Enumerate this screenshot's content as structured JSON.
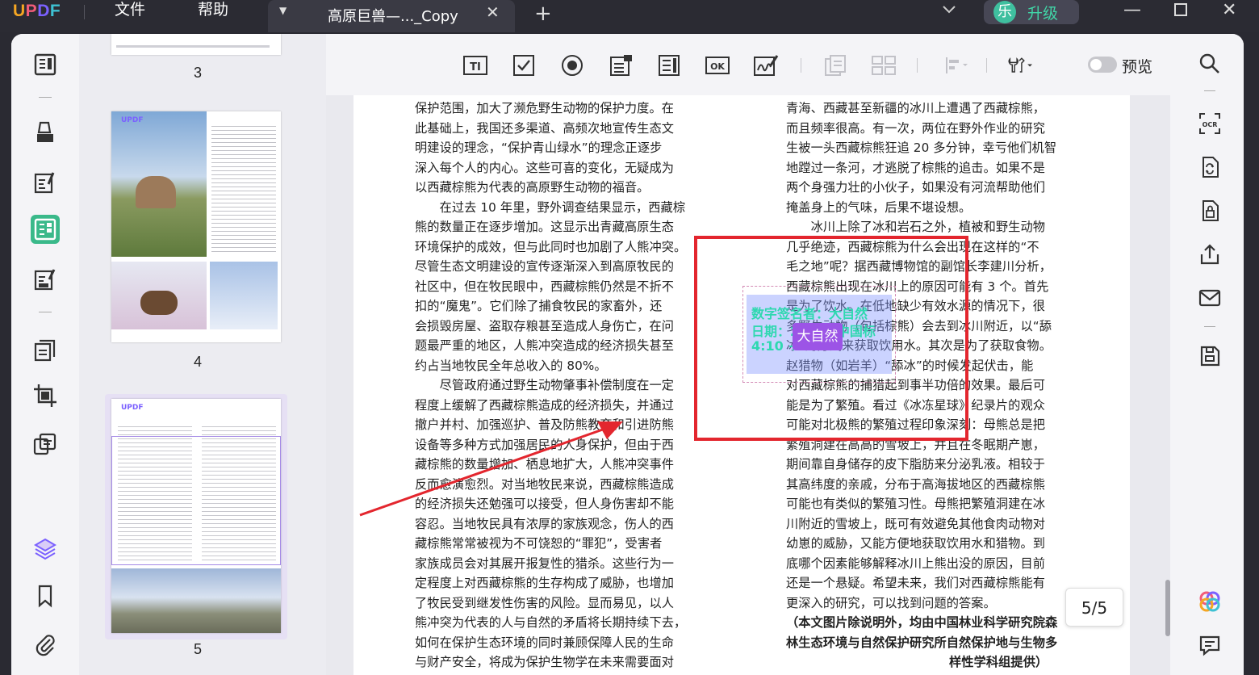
{
  "app": {
    "logo": {
      "u": "U",
      "p": "P",
      "d": "D",
      "f": "F"
    },
    "menu": {
      "file": "文件",
      "help": "帮助"
    },
    "tab_title": "高原巨兽—..._Copy",
    "upgrade": {
      "avatar": "乐",
      "label": "升级"
    },
    "accent_color": "#3ab98a"
  },
  "thumbnails": {
    "pages": [
      {
        "number": "3"
      },
      {
        "number": "4"
      },
      {
        "number": "5"
      }
    ]
  },
  "form_toolbar": {
    "preview_label": "预览",
    "ok_label": "OK",
    "text_label": "TI"
  },
  "document": {
    "left_column": [
      "保护范围，加大了濒危野生动物的保护力度。在",
      "此基础上，我国还多渠道、高频次地宣传生态文",
      "明建设的理念，“保护青山绿水”的理念正逐步",
      "深入每个人的内心。这些可喜的变化，无疑成为",
      "以西藏棕熊为代表的高原野生动物的福音。",
      "　　在过去 10 年里，野外调查结果显示，西藏棕",
      "熊的数量正在逐步增加。这显示出青藏高原生态",
      "环境保护的成效，但与此同时也加剧了人熊冲突。",
      "尽管生态文明建设的宣传逐渐深入到高原牧民的",
      "社区中，但在牧民眼中，西藏棕熊仍然是不折不",
      "扣的“魔鬼”。它们除了捕食牧民的家畜外，还",
      "会损毁房屋、盗取存粮甚至造成人身伤亡，在问",
      "题最严重的地区，人熊冲突造成的经济损失甚至",
      "约占当地牧民全年总收入的 80%。",
      "　　尽管政府通过野生动物肇事补偿制度在一定",
      "程度上缓解了西藏棕熊造成的经济损失，并通过",
      "撤户并村、加强巡护、普及防熊教育和引进防熊",
      "设备等多种方式加强居民的人身保护，但由于西",
      "藏棕熊的数量增加、栖息地扩大，人熊冲突事件",
      "反而愈演愈烈。对当地牧民来说，西藏棕熊造成",
      "的经济损失还勉强可以接受，但人身伤害却不能",
      "容忍。当地牧民具有浓厚的家族观念，伤人的西",
      "藏棕熊常常被视为不可饶恕的“罪犯”，受害者",
      "家族成员会对其展开报复性的猎杀。这些行为一",
      "定程度上对西藏棕熊的生存构成了威胁，也增加",
      "了牧民受到继发性伤害的风险。显而易见，以人",
      "熊冲突为代表的人与自然的矛盾将长期持续下去，",
      "如何在保护生态环境的同时兼顾保障人民的生命",
      "与财产安全，将成为保护生物学在未来需要面对"
    ],
    "right_column": [
      "青海、西藏甚至新疆的冰川上遭遇了西藏棕熊，",
      "而且频率很高。有一次，两位在野外作业的研究",
      "生被一头西藏棕熊狂追 20 多分钟，幸亏他们机智",
      "地蹚过一条河，才逃脱了棕熊的追击。如果不是",
      "两个身强力壮的小伙子，如果没有河流帮助他们",
      "掩盖身上的气味，后果不堪设想。",
      "　　冰川上除了冰和岩石之外，植被和野生动物",
      "几乎绝迹，西藏棕熊为什么会出现在这样的“不",
      "毛之地”呢？据西藏博物馆的副馆长李建川分析，",
      "西藏棕熊出现在冰川上的原因可能有 3 个。首先",
      "是为了饮水。在低地缺少有效水源的情况下，很",
      "多野生动物（包括棕熊）会去到冰川附近，以“舔",
      "冰”的方式来获取饮用水。其次是为了获取食物。",
      "赵猎物（如岩羊）“舔冰”的时候发起伏击，能",
      "对西藏棕熊的捕猎起到事半功倍的效果。最后可",
      "能是为了繁殖。看过《冰冻星球》纪录片的观众",
      "可能对北极熊的繁殖过程印象深刻：母熊总是把",
      "繁殖洞建在高高的雪坡上，并且在冬眠期产崽，",
      "期间靠自身储存的皮下脂肪来分泌乳液。相较于",
      "其高纬度的亲戚，分布于高海拔地区的西藏棕熊",
      "可能也有类似的繁殖习性。母熊把繁殖洞建在冰",
      "川附近的雪坡上，既可有效避免其他食肉动物对",
      "幼崽的威胁，又能方便地获取饮用水和猎物。到",
      "底哪个因素能够解释冰川上熊出没的原因，目前",
      "还是一个悬疑。希望未来，我们对西藏棕熊能有",
      "更深入的研究，可以找到问题的答案。"
    ],
    "caption_lines": [
      "（本文图片除说明外，均由中国林业科学研究院森",
      "林生态环境与自然保护研究所自然保护地与生物多",
      "样性学科组提供）"
    ],
    "signature": {
      "line1": "数字签名者：大自然",
      "line2": "日期：2023.(中国标",
      "line3": "4:10 +08'00'",
      "tooltip": "大自然"
    },
    "page_indicator": "5/5"
  }
}
